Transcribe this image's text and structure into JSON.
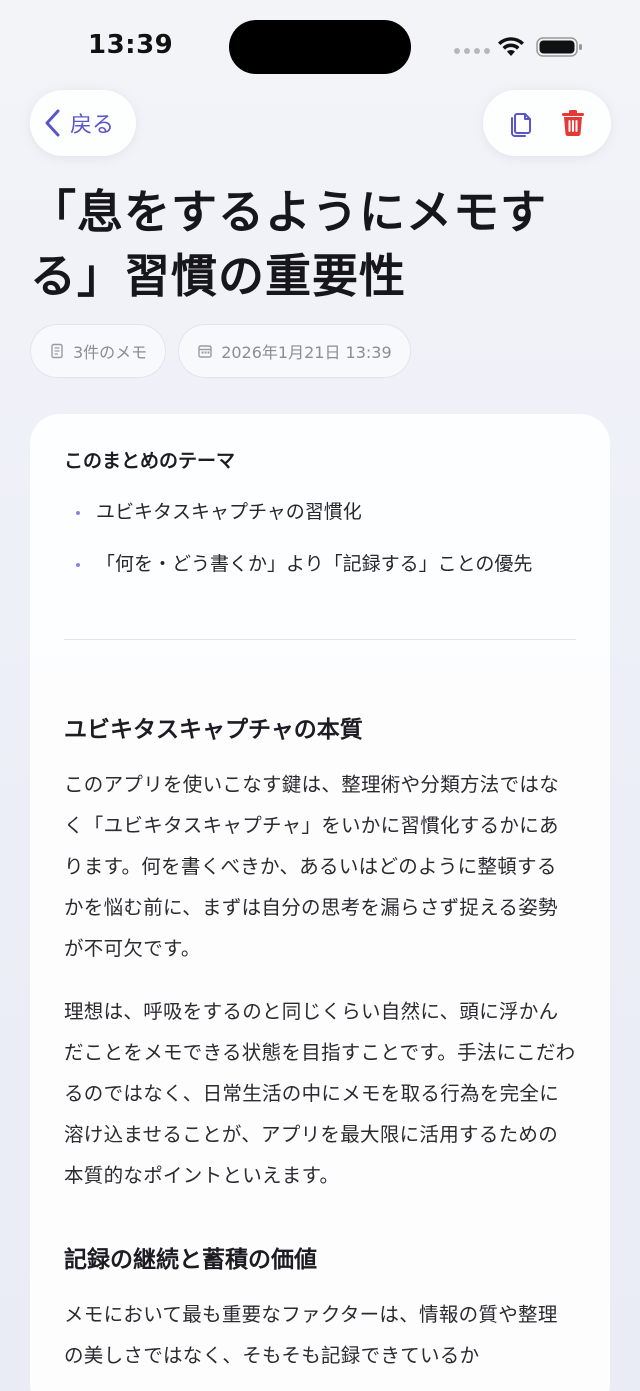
{
  "status_bar": {
    "time": "13:39"
  },
  "nav": {
    "back_label": "戻る",
    "icons": {
      "back": "chevron-left-icon",
      "copy": "copy-icon",
      "delete": "trash-icon"
    },
    "accent_color": "#5a56c8",
    "delete_color": "#e53935"
  },
  "page": {
    "title": "「息をするようにメモする」習慣の重要性",
    "meta": {
      "count": "3件のメモ",
      "date": "2026年1月21日 13:39"
    }
  },
  "card": {
    "theme_heading": "このまとめのテーマ",
    "theme_items": [
      "ユビキタスキャプチャの習慣化",
      "「何を・どう書くか」より「記録する」ことの優先"
    ],
    "sections": [
      {
        "title": "ユビキタスキャプチャの本質",
        "paragraphs": [
          "このアプリを使いこなす鍵は、整理術や分類方法ではなく「ユビキタスキャプチャ」をいかに習慣化するかにあります。何を書くべきか、あるいはどのように整頓するかを悩む前に、まずは自分の思考を漏らさず捉える姿勢が不可欠です。",
          "理想は、呼吸をするのと同じくらい自然に、頭に浮かんだことをメモできる状態を目指すことです。手法にこだわるのではなく、日常生活の中にメモを取る行為を完全に溶け込ませることが、アプリを最大限に活用するための本質的なポイントといえます。"
        ]
      },
      {
        "title": "記録の継続と蓄積の価値",
        "paragraphs": [
          "メモにおいて最も重要なファクターは、情報の質や整理の美しさではなく、そもそも記録できているか"
        ]
      }
    ]
  }
}
